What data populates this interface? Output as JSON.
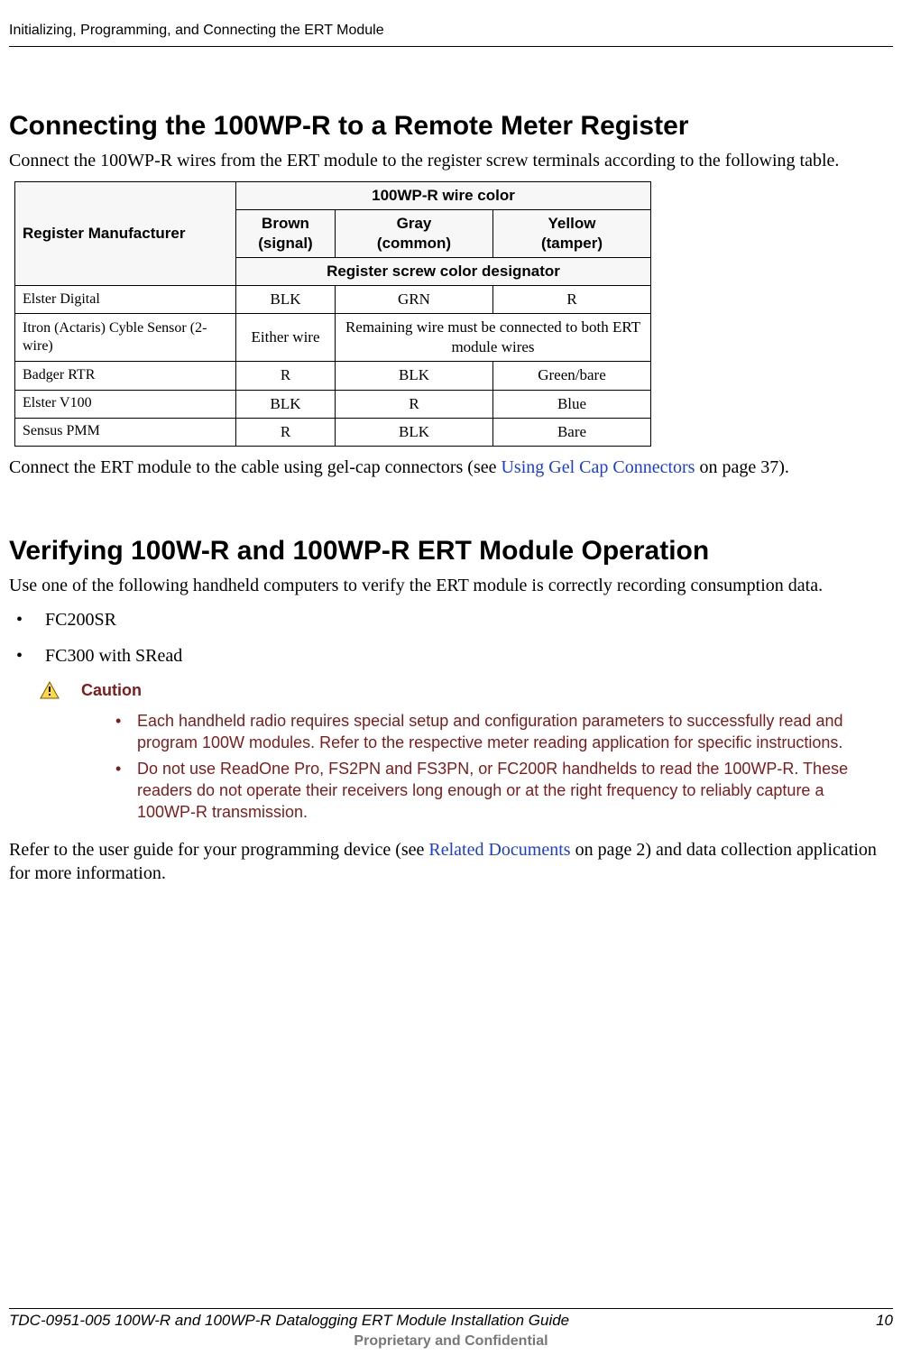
{
  "header": {
    "chapter_title": "Initializing, Programming, and Connecting the ERT Module"
  },
  "section1": {
    "heading": "Connecting the 100WP-R to a Remote Meter Register",
    "intro": "Connect the 100WP-R wires from the ERT module to the register screw terminals according to the following table.",
    "table": {
      "top_group": "100WP-R wire color",
      "mfr_header": "Register Manufacturer",
      "cols": {
        "brown": {
          "label": "Brown",
          "sub": "(signal)"
        },
        "gray": {
          "label": "Gray",
          "sub": "(common)"
        },
        "yellow": {
          "label": "Yellow",
          "sub": "(tamper)"
        }
      },
      "designator": "Register screw color designator",
      "rows": [
        {
          "mfr": "Elster Digital",
          "brown": "BLK",
          "gray": "GRN",
          "yellow": "R"
        },
        {
          "mfr": "Itron (Actaris) Cyble Sensor (2-wire)",
          "brown": "Either wire",
          "gray_yellow_merged": "Remaining wire must be connected to both ERT module wires"
        },
        {
          "mfr": "Badger RTR",
          "brown": "R",
          "gray": "BLK",
          "yellow": "Green/bare"
        },
        {
          "mfr": "Elster V100",
          "brown": "BLK",
          "gray": "R",
          "yellow": "Blue"
        },
        {
          "mfr": "Sensus PMM",
          "brown": "R",
          "gray": "BLK",
          "yellow": "Bare"
        }
      ]
    },
    "after_table_prefix": "Connect the ERT module to the cable using gel-cap connectors (see ",
    "after_table_link": "Using Gel Cap Connectors",
    "after_table_suffix": " on page 37)."
  },
  "section2": {
    "heading": "Verifying 100W-R and 100WP-R ERT Module Operation",
    "intro": "Use one of the following handheld computers to verify the ERT module is correctly recording consumption data.",
    "items": [
      "FC200SR",
      "FC300 with SRead"
    ],
    "caution_label": "Caution",
    "caution_items": [
      "Each handheld radio requires special setup and configuration parameters to successfully read and program 100W modules. Refer to the respective meter reading application for specific instructions.",
      "Do not use ReadOne Pro, FS2PN and FS3PN, or FC200R handhelds to read the 100WP-R. These readers do not operate their receivers long enough or at the right frequency to reliably capture a 100WP-R transmission."
    ],
    "closing_prefix": "Refer to the user guide for your programming device (see ",
    "closing_link": "Related Documents",
    "closing_suffix": " on page 2) and data collection application for more information."
  },
  "footer": {
    "doc_id": "TDC-0951-005 100W-R and 100WP-R Datalogging ERT Module Installation Guide",
    "page": "10",
    "confidential": "Proprietary and Confidential"
  }
}
